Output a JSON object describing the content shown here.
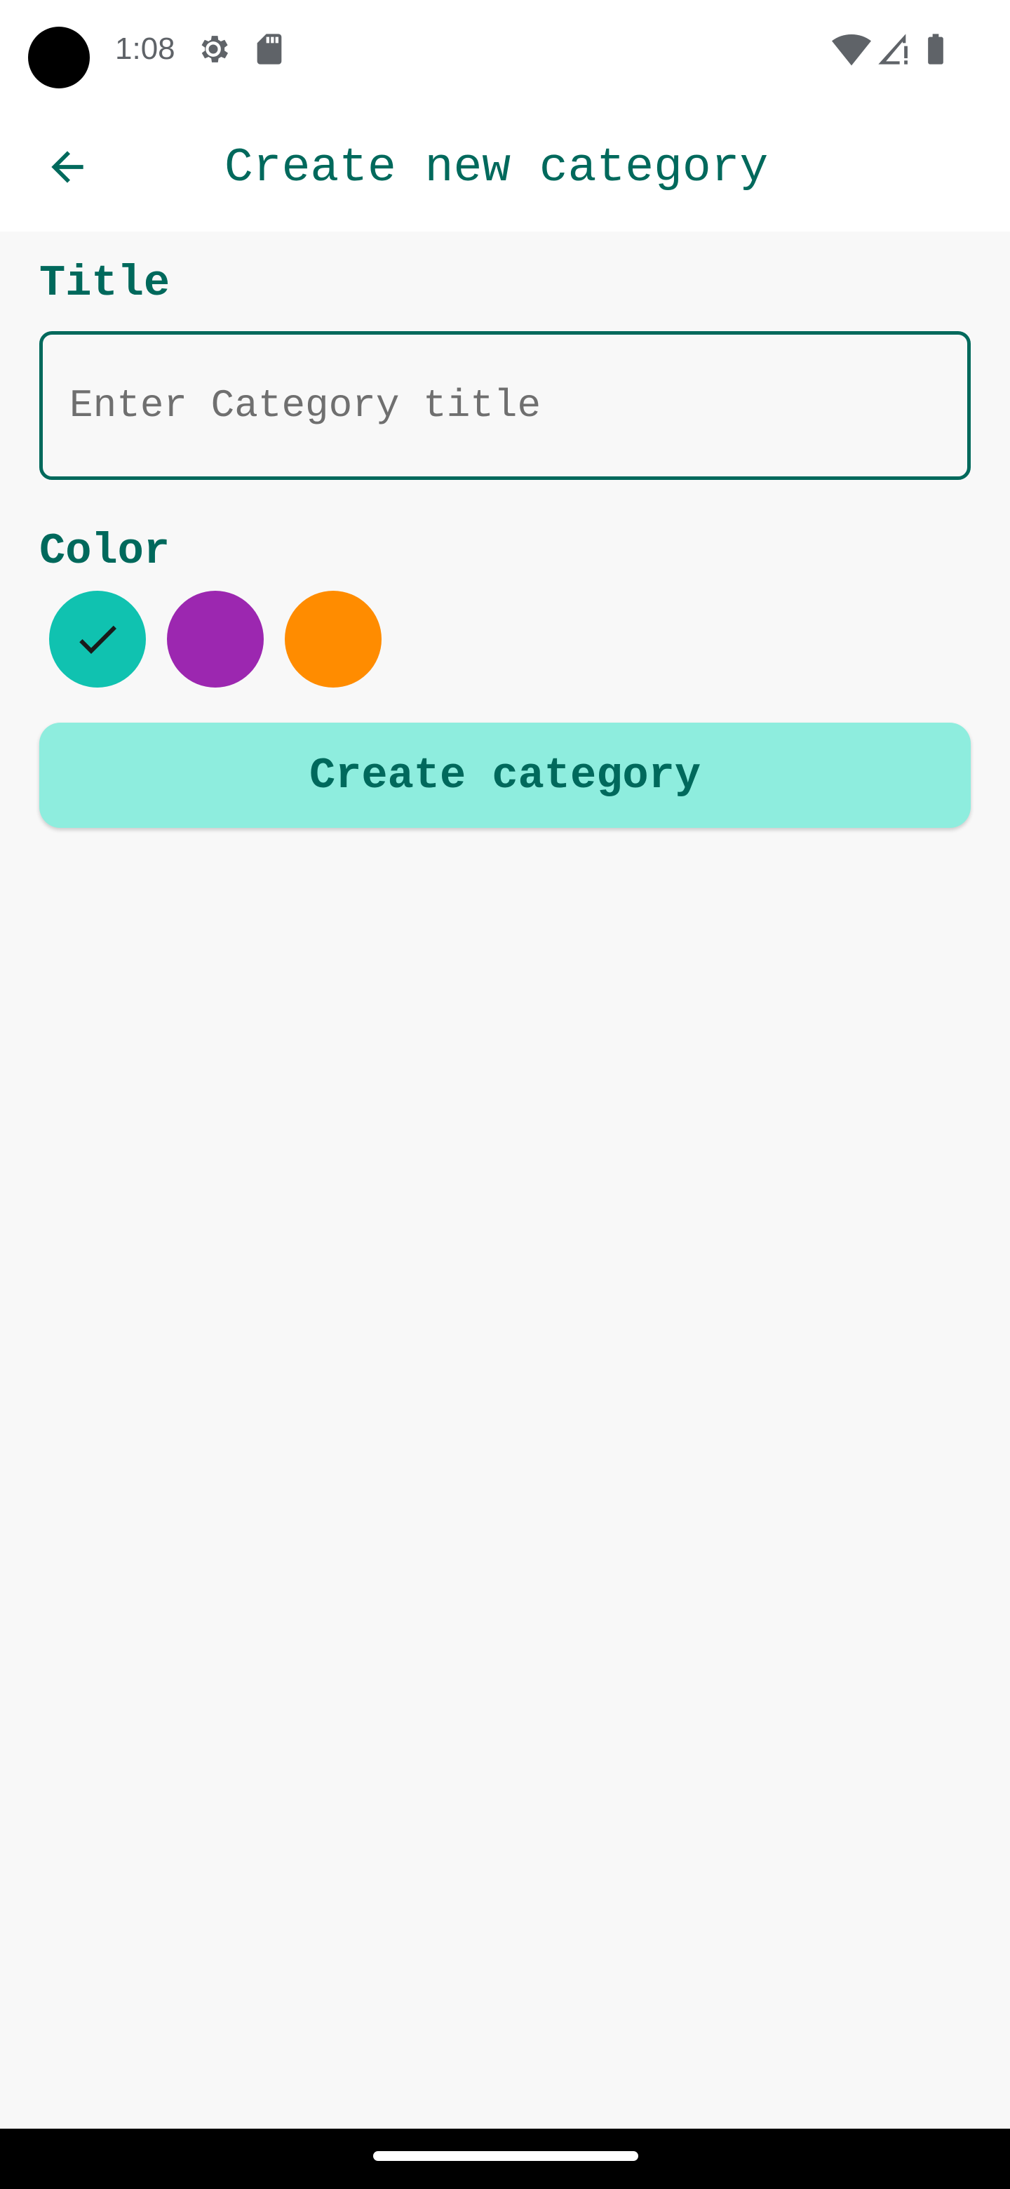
{
  "status_bar": {
    "time": "1:08",
    "icons": [
      "settings-icon",
      "sd-card-icon",
      "wifi-icon",
      "cell-signal-icon",
      "battery-icon"
    ]
  },
  "app_bar": {
    "back_icon": "arrow-back-icon",
    "title": "Create new category"
  },
  "form": {
    "title_label": "Title",
    "title_input": {
      "value": "",
      "placeholder": "Enter Category title"
    },
    "color_label": "Color",
    "colors": [
      {
        "name": "teal",
        "hex": "#10C2B0",
        "selected": true
      },
      {
        "name": "purple",
        "hex": "#9C27B0",
        "selected": false
      },
      {
        "name": "orange",
        "hex": "#FF8C00",
        "selected": false
      }
    ],
    "submit_label": "Create category"
  },
  "theme": {
    "primary": "#00695C",
    "button_bg": "#8EEDDE",
    "background": "#F8F8F8"
  }
}
